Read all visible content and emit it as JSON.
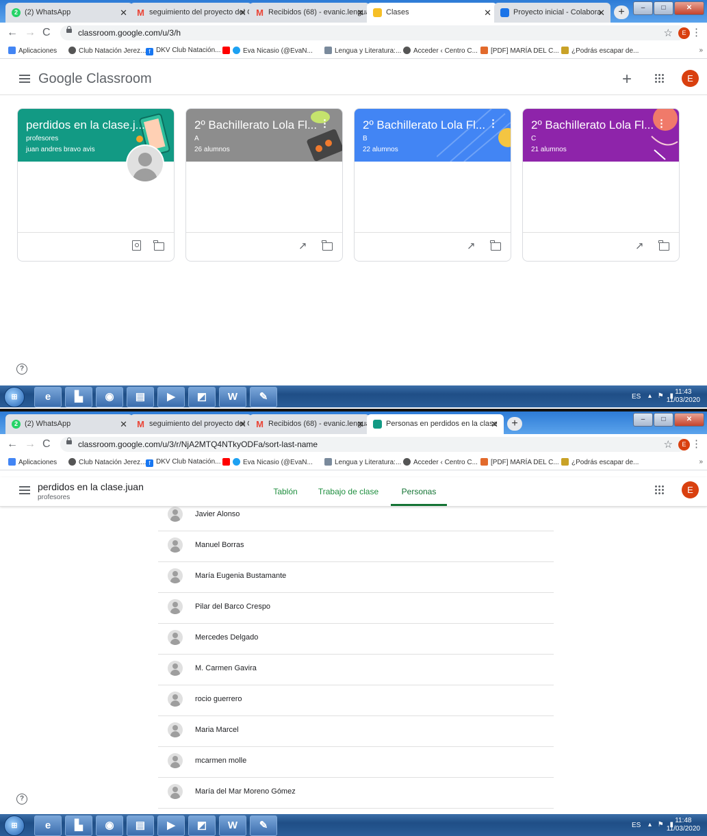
{
  "shot1": {
    "tabs": [
      {
        "label": "(2) WhatsApp",
        "fav": "2",
        "color": "#25d366"
      },
      {
        "label": "seguimiento del proyecto del G",
        "fav": "M",
        "color": "#ea4335"
      },
      {
        "label": "Recibidos (68) - evanic.lengua@",
        "fav": "M",
        "color": "#ea4335"
      },
      {
        "label": "Clases",
        "fav": "",
        "color": "#f6bf26"
      },
      {
        "label": "Proyecto inicial - Colabora",
        "fav": "",
        "color": "#1a73e8"
      }
    ],
    "url": "classroom.google.com/u/3/h",
    "bookmarks": [
      "Aplicaciones",
      "Club Natación Jerez...",
      "DKV Club Natación...",
      "Eva Nicasio (@EvaN...",
      "Lengua y Literatura:...",
      "Acceder ‹ Centro C...",
      "[PDF] MARÍA DEL C...",
      "¿Podrás escapar de..."
    ],
    "logo_google": "Google",
    "logo_classroom": "Classroom",
    "avatar_letter": "E",
    "cards": [
      {
        "title": "perdidos en la clase.j...",
        "section": "profesores",
        "subtitle": "juan andres bravo avis",
        "color": "#129a84"
      },
      {
        "title": "2º Bachillerato Lola Fl...",
        "section": "A",
        "subtitle": "26 alumnos",
        "color": "#8d8d8d"
      },
      {
        "title": "2º Bachillerato Lola Fl...",
        "section": "B",
        "subtitle": "22 alumnos",
        "color": "#4285f4"
      },
      {
        "title": "2º Bachillerato Lola Fl...",
        "section": "C",
        "subtitle": "21 alumnos",
        "color": "#8e24aa"
      }
    ],
    "help_icon": "?",
    "taskbar": {
      "lang": "ES",
      "time": "11:43",
      "date": "11/03/2020"
    }
  },
  "shot2": {
    "tabs": [
      {
        "label": "(2) WhatsApp",
        "fav": "2",
        "color": "#25d366"
      },
      {
        "label": "seguimiento del proyecto del GT",
        "fav": "M",
        "color": "#ea4335"
      },
      {
        "label": "Recibidos (68) - evanic.lengua@",
        "fav": "M",
        "color": "#ea4335"
      },
      {
        "label": "Personas en perdidos en la clase",
        "fav": "",
        "color": "#129a84"
      }
    ],
    "url": "classroom.google.com/u/3/r/NjA2MTQ4NTkyODFa/sort-last-name",
    "class_name": "perdidos en la clase.juan",
    "class_role": "profesores",
    "nav_tabs": [
      "Tablón",
      "Trabajo de clase",
      "Personas"
    ],
    "people": [
      "Javier Alonso",
      "Manuel Borras",
      "María Eugenia Bustamante",
      "Pilar del Barco Crespo",
      "Mercedes Delgado",
      "M. Carmen Gavira",
      "rocio guerrero",
      "Maria Marcel",
      "mcarmen molle",
      "María del Mar Moreno Gómez"
    ],
    "avatar_letter": "E",
    "help_icon": "?",
    "taskbar": {
      "lang": "ES",
      "time": "11:48",
      "date": "11/03/2020"
    }
  }
}
